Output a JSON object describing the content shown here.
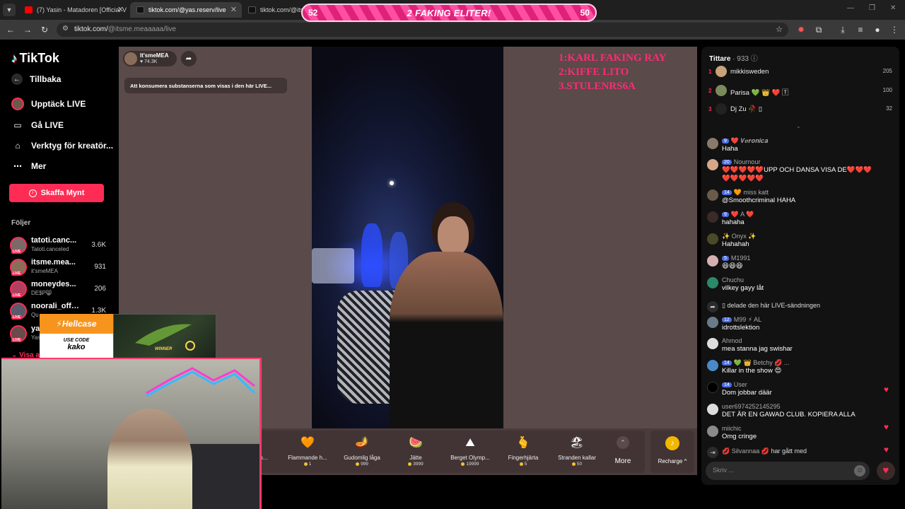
{
  "browser": {
    "tabs": [
      {
        "title": "(7) Yasin - Matadoren [Official V",
        "close": "✕"
      },
      {
        "title": "tiktok.com/@yas.reserv/live",
        "close": "✕"
      },
      {
        "title": "tiktok.com/@itsm",
        "close": ""
      }
    ],
    "url_host": "tiktok.com/",
    "url_path": "@itsme.meaaaaa/live"
  },
  "overlay_bar": {
    "left_score": "52",
    "title": "2 FAKING ELITER!",
    "right_score": "50"
  },
  "sidebar": {
    "logo": "TikTok",
    "back": "Tillbaka",
    "items": [
      {
        "label": "Upptäck LIVE"
      },
      {
        "label": "Gå LIVE"
      },
      {
        "label": "Verktyg för kreatör..."
      },
      {
        "label": "Mer"
      }
    ],
    "coin_button": "Skaffa Mynt",
    "following_title": "Följer",
    "following": [
      {
        "name": "tatoti.canc...",
        "sub": "Tatoti.canceled",
        "count": "3.6K"
      },
      {
        "name": "itsme.mea...",
        "sub": "it'smeMEA",
        "count": "931"
      },
      {
        "name": "moneydes...",
        "sub": "DE$P😸",
        "count": "206"
      },
      {
        "name": "noorali_offi...",
        "sub": "Qu",
        "count": "1.3K"
      },
      {
        "name": "ya",
        "sub": "Yas",
        "count": ""
      }
    ],
    "see_all": "Visa al",
    "live_tag": "LIVE"
  },
  "live": {
    "host_name": "It'smeMEA",
    "host_likes": "♥ 74.3K",
    "warning": "Att konsumera substanserna som visas i den här LIVE...",
    "ranking": [
      "1:KARL FAKING RAY",
      "2:KIFFE LITO",
      "3.STULENRS6A"
    ],
    "gifts": [
      {
        "name": "Själän...",
        "price": "",
        "icon": "🦌"
      },
      {
        "name": "Flammande h...",
        "price": "1",
        "icon": "🧡"
      },
      {
        "name": "Gudomlig låga",
        "price": "999",
        "icon": "🪔"
      },
      {
        "name": "Jätte",
        "price": "3999",
        "icon": "🍉"
      },
      {
        "name": "Berget Olymp...",
        "price": "19999",
        "icon": "⛰"
      },
      {
        "name": "Fingerhjärta",
        "price": "5",
        "icon": "🫰"
      },
      {
        "name": "Stranden kallar",
        "price": "50",
        "icon": "🏖"
      }
    ],
    "more_label": "More",
    "recharge_label": "Recharge ^"
  },
  "chat": {
    "viewers_label": "Tittare",
    "viewers_count": "· 933",
    "top_viewers": [
      {
        "rank": "1",
        "name": "mikkisweden",
        "score": "205",
        "color": "#c8a27a"
      },
      {
        "rank": "2",
        "name": "Parisa 💚 👑 ❤️ 🅃",
        "score": "100",
        "color": "#7a8a5a"
      },
      {
        "rank": "3",
        "name": "Dj Zu 🥀 ▯",
        "score": "32",
        "color": "#222222"
      }
    ],
    "messages": [
      {
        "level": "9",
        "name": "❤️ 𝑽𝒆𝒓𝒐𝒏𝒊𝒄𝒂",
        "text": "Haha",
        "color": "#8a7a6a"
      },
      {
        "level": "20",
        "name": "Nournour",
        "text": "❤️❤️❤️❤️❤️UPP OCH DANSA VISA DE❤️❤️❤️❤️❤️❤️❤️❤️",
        "color": "#d6a88a"
      },
      {
        "level": "14",
        "name": "🧡 miss katt",
        "text": "@Smoothcriminal HAHA",
        "color": "#6a5a4a"
      },
      {
        "level": "9",
        "name": "❤️ A ❤️",
        "text": "hahaha",
        "color": "#3a2a2a"
      },
      {
        "level": "",
        "name": "✨ Onyx ✨",
        "text": "Hahahah",
        "color": "#4a4a2a"
      },
      {
        "level": "5",
        "name": "M1991",
        "text": "😆😆😆",
        "color": "#d6b0b0"
      },
      {
        "level": "",
        "name": "Chuchu",
        "text": "vilkey gayy låt",
        "color": "#2a8a6a"
      },
      {
        "level": "",
        "name": "",
        "text": "▯ delade den här LIVE-sändningen",
        "color": ""
      },
      {
        "level": "12",
        "name": "M99 ⚡ AL",
        "text": "idrottslektion",
        "color": "#6a7a8a"
      },
      {
        "level": "",
        "name": "Ahmod",
        "text": "mea stanna jag swishar",
        "color": "#dddddd"
      },
      {
        "level": "14",
        "name": "💚 👑 Betchy 💋 ...",
        "text": "Killar in the show 😍",
        "color": "#4a8ac8"
      },
      {
        "level": "14",
        "name": "User",
        "text": "Dom jobbar däär",
        "color": "#000000"
      },
      {
        "level": "",
        "name": "user6974252145295",
        "text": "DET ÄR EN GAWAD CLUB. KOPIERA ALLA",
        "color": "#dddddd"
      },
      {
        "level": "",
        "name": "miichic",
        "text": "Omg cringe",
        "color": "#8a8a8a"
      },
      {
        "level": "",
        "name": "💋 Silvannaa 💋",
        "text": "har gått med",
        "color": ""
      }
    ],
    "input_placeholder": "Skriv ..."
  },
  "streamer_overlay": {
    "brand": "⚡Hellcase",
    "use_code": "USE CODE",
    "code": "kako",
    "winner": "WINNER"
  }
}
